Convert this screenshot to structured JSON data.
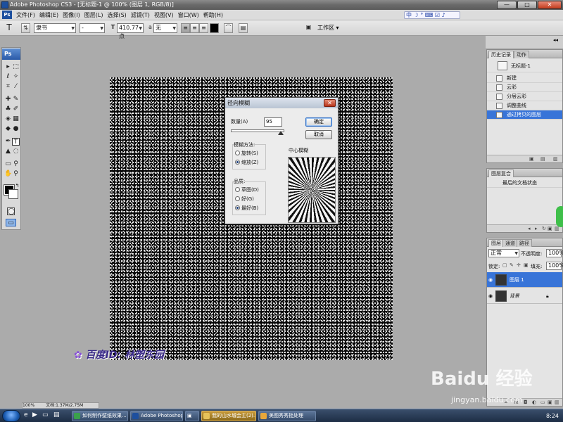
{
  "window": {
    "title": "Adobe Photoshop CS3 - [无标题-1 @ 100% (图层 1, RGB/8)]",
    "controls": {
      "minimize": "—",
      "maximize": "□",
      "close": "✕"
    }
  },
  "menubar": [
    "文件(F)",
    "编辑(E)",
    "图像(I)",
    "图层(L)",
    "选择(S)",
    "滤镜(T)",
    "视图(V)",
    "窗口(W)",
    "帮助(H)"
  ],
  "ime": {
    "label": "中"
  },
  "options": {
    "tool_glyph": "T",
    "font_family": "隶书",
    "font_style": "-",
    "font_size": "410.77 点",
    "antialias": "无",
    "workspace": "工作区",
    "text_color": "#000000"
  },
  "tools": {
    "badge": "Ps"
  },
  "dialog": {
    "title": "径向模糊",
    "close": "✕",
    "amount_label": "数量(A)",
    "amount_value": "95",
    "ok_label": "确定",
    "cancel_label": "取消",
    "method_group": "模糊方法:",
    "method_options": [
      "旋转(S)",
      "缩放(Z)"
    ],
    "method_selected": "缩放(Z)",
    "quality_group": "品质:",
    "quality_options": [
      "草图(D)",
      "好(G)",
      "最好(B)"
    ],
    "quality_selected": "最好(B)",
    "center_label": "中心模糊"
  },
  "history_panel": {
    "tabs": [
      "历史记录",
      "动作"
    ],
    "snapshot": "无标题-1",
    "items": [
      "新建",
      "云彩",
      "分层云彩",
      "调整曲线",
      "通过拷贝的图层"
    ],
    "selected": "通过拷贝的图层"
  },
  "layercomp_panel": {
    "tabs": [
      "图层复合"
    ],
    "item": "最后的文档状态"
  },
  "layers_panel": {
    "tabs": [
      "图层",
      "通道",
      "路径"
    ],
    "blend_mode": "正常",
    "opacity_label": "不透明度:",
    "opacity_value": "100%",
    "lock_label": "锁定:",
    "fill_label": "填充:",
    "fill_value": "100%",
    "layers": [
      {
        "name": "图层 1",
        "selected": true
      },
      {
        "name": "背景",
        "selected": false
      }
    ]
  },
  "watermark": {
    "signature": "百度ID: 林塑东园",
    "site": "jingyan.baidu.com",
    "logo": "Baidu 经验"
  },
  "status": {
    "zoom": "100%",
    "doc": "文档:1.37M/2.75M"
  },
  "taskbar": {
    "items": [
      "如何制作壁纸效果...",
      "Adobe Photoshop ...",
      "我的山水城会主(2)...",
      "美图秀秀批处理"
    ],
    "active_index": 2,
    "clock": "8:24"
  },
  "colors": {
    "selection": "#3874d8",
    "canvas": "#070707"
  }
}
